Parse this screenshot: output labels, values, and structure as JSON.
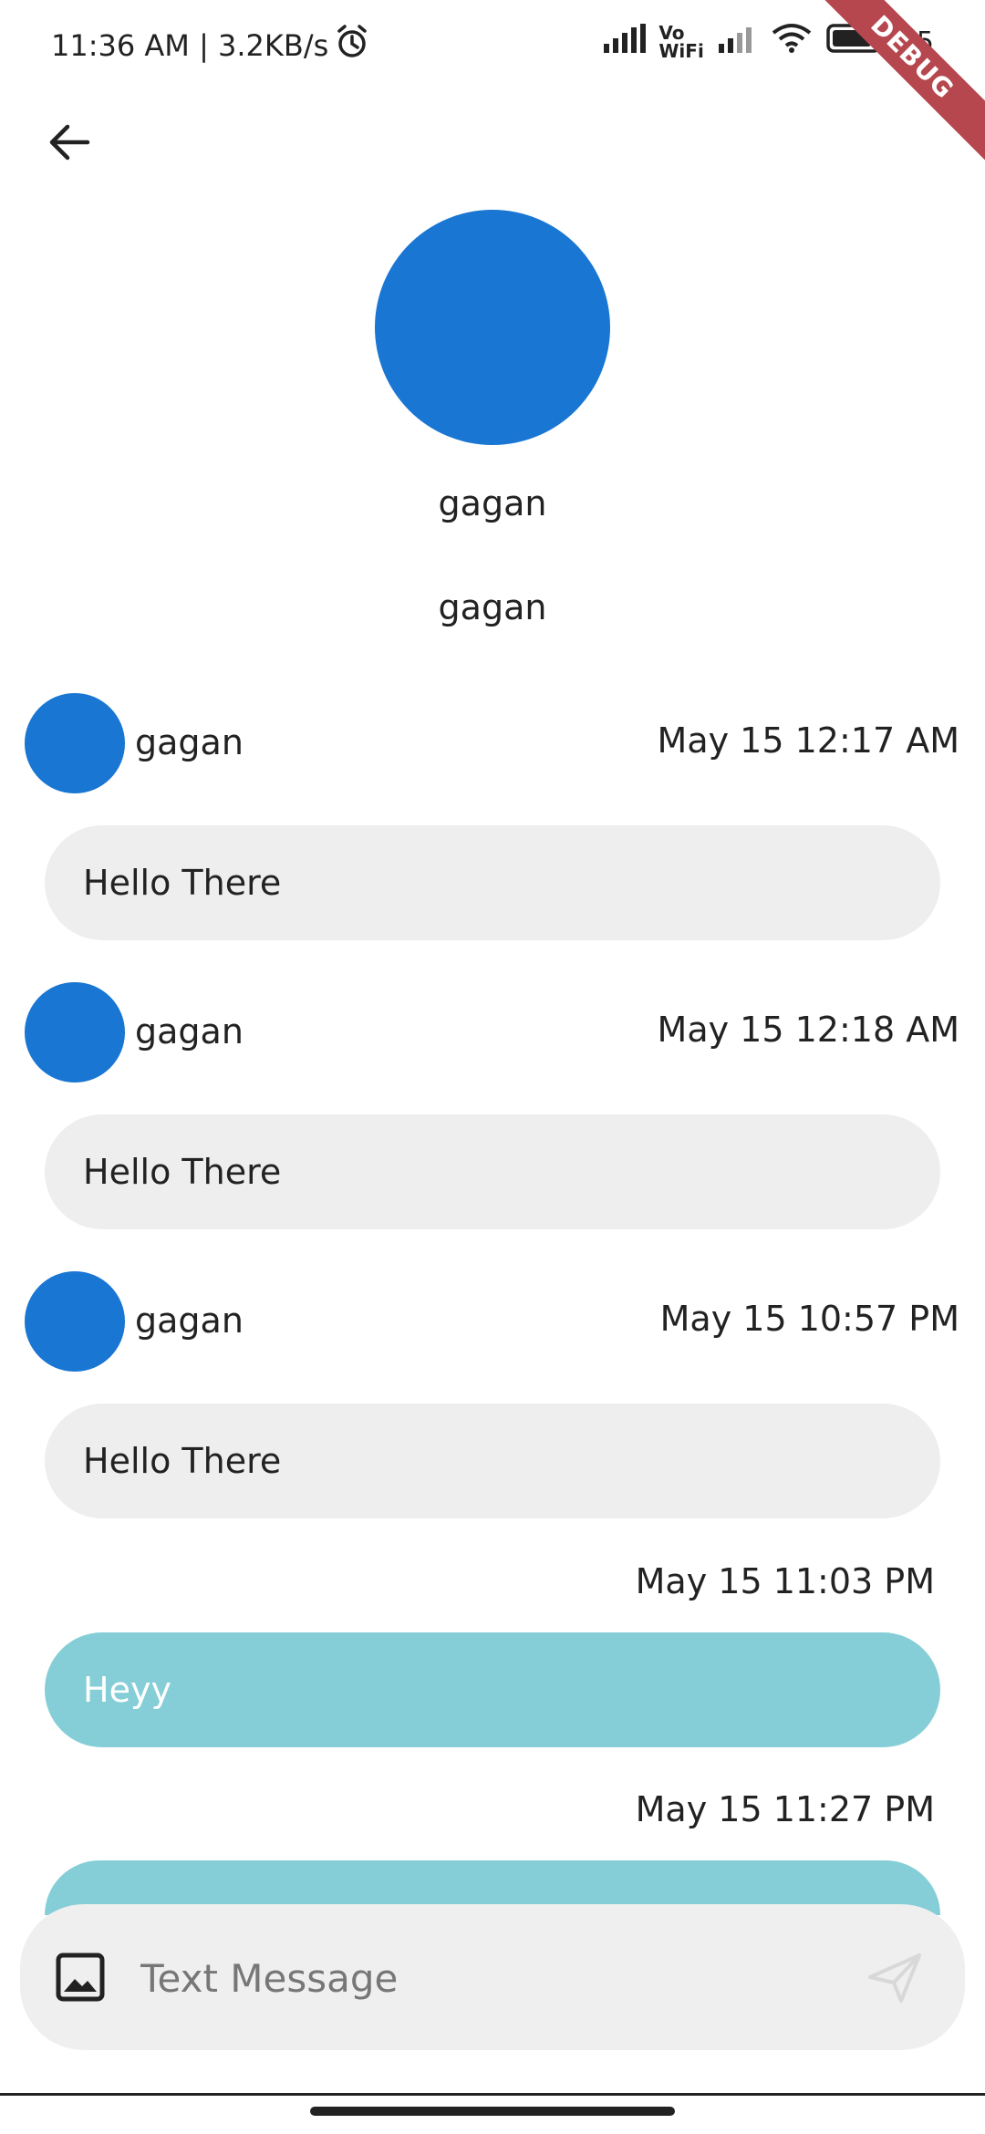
{
  "status_bar": {
    "time_speed": "11:36 AM | 3.2KB/s",
    "battery": "85",
    "volte_label_top": "Vo",
    "volte_label_bottom": "WiFi",
    "debug_label": "DEBUG",
    "icons": [
      "alarm-icon",
      "signal-icon",
      "wifi-icon",
      "battery-icon"
    ]
  },
  "header": {
    "back_icon": "arrow-left-icon"
  },
  "profile": {
    "name": "gagan",
    "handle": "gagan",
    "avatar_color": "#1976d2"
  },
  "messages": [
    {
      "sender": "gagan",
      "time": "May 15 12:17 AM",
      "text": "Hello There"
    },
    {
      "sender": "gagan",
      "time": "May 15 12:18 AM",
      "text": "Hello There"
    },
    {
      "sender": "gagan",
      "time": "May 15 10:57 PM",
      "text": "Hello There"
    }
  ],
  "sent_messages": [
    {
      "time": "May 15 11:03 PM",
      "text": "Heyy"
    },
    {
      "time": "May 15 11:27 PM",
      "text": ""
    }
  ],
  "composer": {
    "placeholder": "Text Message",
    "image_icon": "image-icon",
    "send_icon": "send-icon"
  },
  "colors": {
    "received_bubble": "#eeeeee",
    "sent_bubble": "#86ced7",
    "accent": "#1976d2",
    "debug_banner": "#b7474e"
  }
}
